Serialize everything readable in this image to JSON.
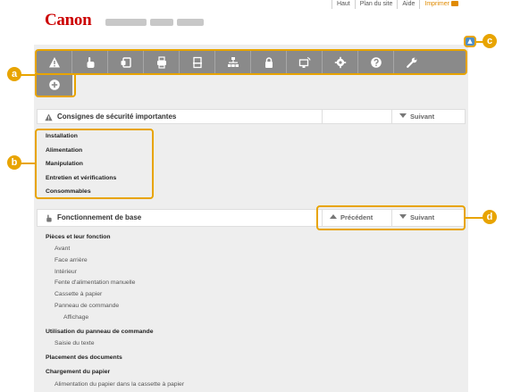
{
  "header": {
    "logo": "Canon",
    "top_links": {
      "home": "Haut",
      "sitemap": "Plan du site",
      "help": "Aide",
      "print": "Imprimer"
    }
  },
  "toolbar": {
    "icons": [
      "warning-icon",
      "hand-icon",
      "copy-icon",
      "fax-icon",
      "scan-icon",
      "network-icon",
      "lock-icon",
      "remote-ui-icon",
      "settings-gear-icon",
      "help-icon",
      "wrench-icon",
      "plus-icon"
    ]
  },
  "callouts": {
    "a": "a",
    "b": "b",
    "c": "c",
    "d": "d"
  },
  "section_safety": {
    "title": "Consignes de sécurité importantes",
    "next": "Suivant",
    "items": [
      "Installation",
      "Alimentation",
      "Manipulation",
      "Entretien et vérifications",
      "Consommables"
    ]
  },
  "section_basic": {
    "title": "Fonctionnement de base",
    "prev": "Précédent",
    "next": "Suivant",
    "items": [
      {
        "text": "Pièces et leur fonction",
        "level": 0
      },
      {
        "text": "Avant",
        "level": 1
      },
      {
        "text": "Face arrière",
        "level": 1
      },
      {
        "text": "Intérieur",
        "level": 1
      },
      {
        "text": "Fente d'alimentation manuelle",
        "level": 1
      },
      {
        "text": "Cassette à papier",
        "level": 1
      },
      {
        "text": "Panneau de commande",
        "level": 1
      },
      {
        "text": "Affichage",
        "level": 2
      },
      {
        "text": "Utilisation du panneau de commande",
        "level": 0
      },
      {
        "text": "Saisie du texte",
        "level": 1
      },
      {
        "text": "Placement des documents",
        "level": 0
      },
      {
        "text": "Chargement du papier",
        "level": 0
      },
      {
        "text": "Alimentation du papier dans la cassette à papier",
        "level": 1
      }
    ]
  },
  "colors": {
    "callout": "#e8a400",
    "brand": "#cc0000",
    "toolbar": "#8a8a8a",
    "print_link": "#e08a00",
    "scroll_top": "#4f8fc9"
  }
}
